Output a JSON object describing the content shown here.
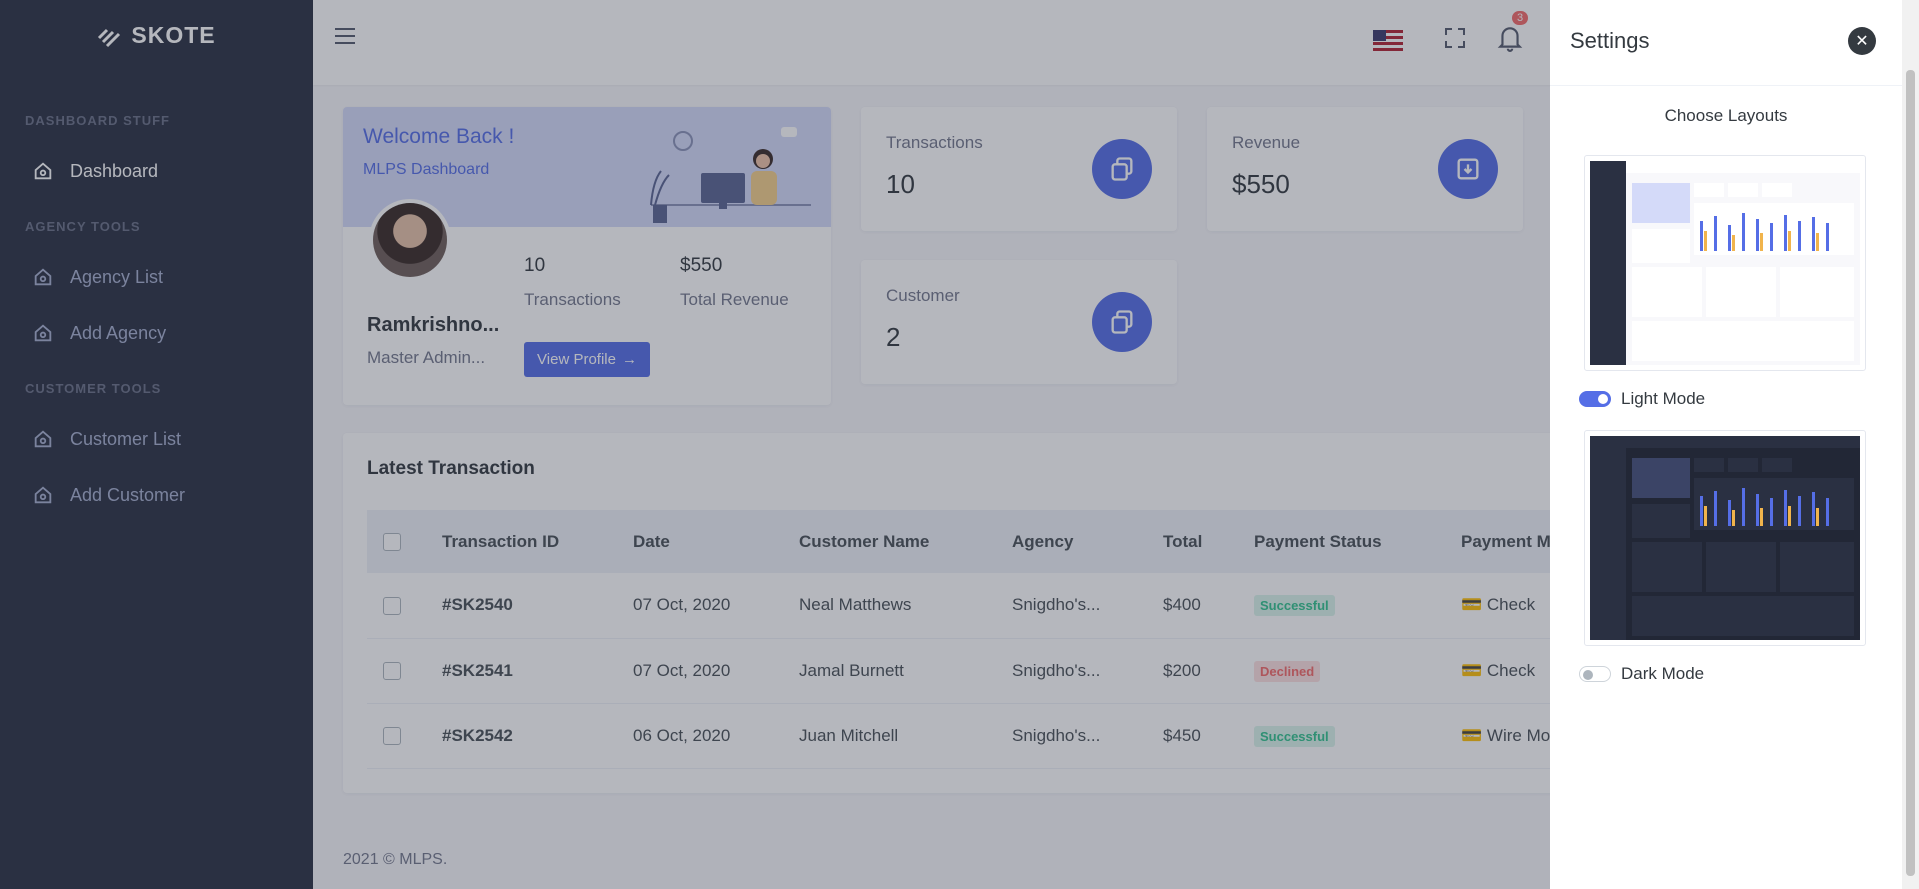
{
  "brand": {
    "name": "SKOTE"
  },
  "sidebar": {
    "sections": [
      {
        "title": "DASHBOARD STUFF"
      },
      {
        "title": "AGENCY TOOLS"
      },
      {
        "title": "CUSTOMER TOOLS"
      }
    ],
    "items": [
      {
        "label": "Dashboard"
      },
      {
        "label": "Agency List"
      },
      {
        "label": "Add Agency"
      },
      {
        "label": "Customer List"
      },
      {
        "label": "Add Customer"
      }
    ]
  },
  "topbar": {
    "notification_count": "3"
  },
  "welcome": {
    "title": "Welcome Back !",
    "subtitle": "MLPS Dashboard",
    "name": "Ramkrishno...",
    "role": "Master Admin...",
    "transactions_value": "10",
    "transactions_label": "Transactions",
    "revenue_value": "$550",
    "revenue_label": "Total Revenue",
    "view_profile": "View Profile"
  },
  "stats": [
    {
      "label": "Transactions",
      "value": "10"
    },
    {
      "label": "Revenue",
      "value": "$550"
    },
    {
      "label": "Customer",
      "value": "2"
    }
  ],
  "transactions": {
    "title": "Latest Transaction",
    "columns": [
      "Transaction ID",
      "Date",
      "Customer Name",
      "Agency",
      "Total",
      "Payment Status",
      "Payment M"
    ],
    "rows": [
      {
        "id": "#SK2540",
        "date": "07 Oct, 2020",
        "customer": "Neal Matthews",
        "agency": "Snigdho's...",
        "total": "$400",
        "status": "Successful",
        "method": "Check"
      },
      {
        "id": "#SK2541",
        "date": "07 Oct, 2020",
        "customer": "Jamal Burnett",
        "agency": "Snigdho's...",
        "total": "$200",
        "status": "Declined",
        "method": "Check"
      },
      {
        "id": "#SK2542",
        "date": "06 Oct, 2020",
        "customer": "Juan Mitchell",
        "agency": "Snigdho's...",
        "total": "$450",
        "status": "Successful",
        "method": "Wire Mo"
      }
    ]
  },
  "footer": {
    "text": "2021 © MLPS."
  },
  "settings": {
    "title": "Settings",
    "choose_layouts": "Choose Layouts",
    "light_mode": "Light Mode",
    "dark_mode": "Dark Mode"
  },
  "colors": {
    "primary": "#556ee6",
    "sidebar": "#2a3042",
    "success": "#34c38f",
    "danger": "#f46a6a"
  }
}
